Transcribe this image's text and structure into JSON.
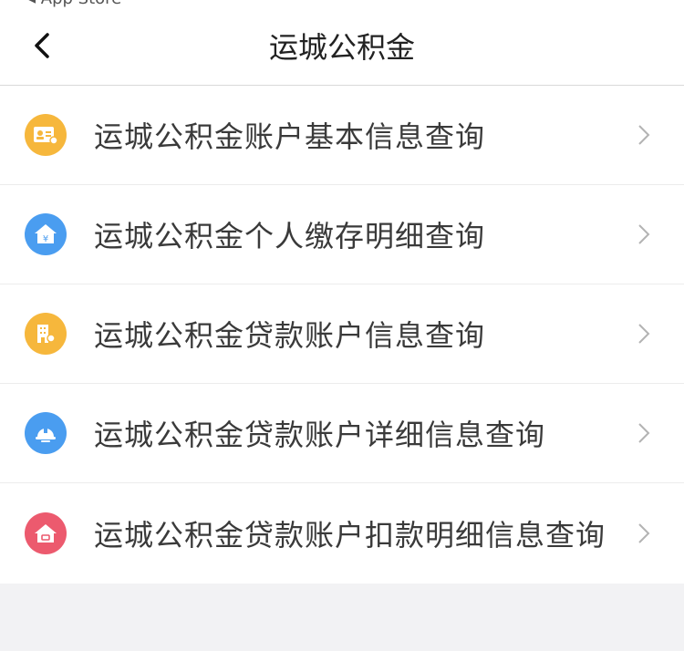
{
  "status": {
    "text": "◂ App Store"
  },
  "nav": {
    "title": "运城公积金"
  },
  "menu": {
    "items": [
      {
        "label": "运城公积金账户基本信息查询",
        "icon": "id-card-icon",
        "color": "#f6b73c"
      },
      {
        "label": "运城公积金个人缴存明细查询",
        "icon": "money-house-icon",
        "color": "#4a9df0"
      },
      {
        "label": "运城公积金贷款账户信息查询",
        "icon": "building-icon",
        "color": "#f6b73c"
      },
      {
        "label": "运城公积金贷款账户详细信息查询",
        "icon": "helmet-icon",
        "color": "#4a9df0"
      },
      {
        "label": "运城公积金贷款账户扣款明细信息查询",
        "icon": "home-icon",
        "color": "#ec5a6e"
      }
    ]
  },
  "colors": {
    "accent": "#4a9df0",
    "background": "#f2f2f4"
  }
}
